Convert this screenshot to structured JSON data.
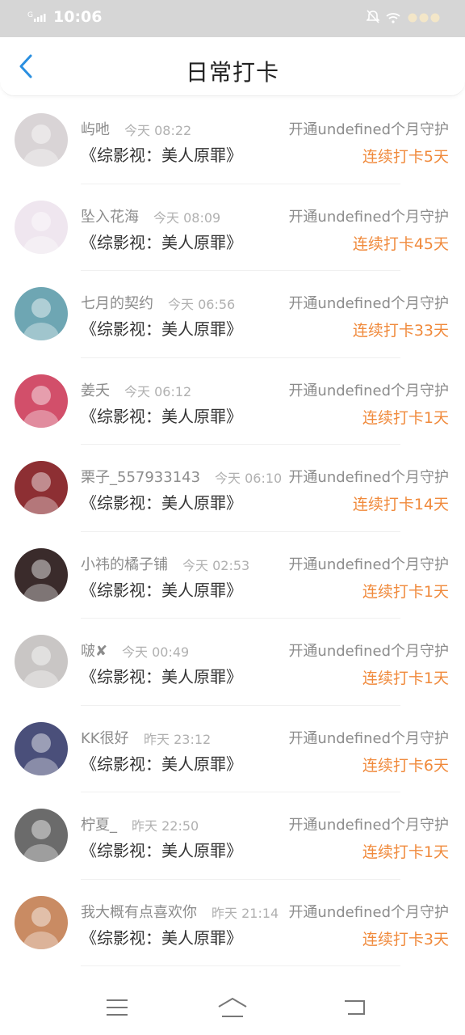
{
  "status_bar": {
    "time": "10:06",
    "network": "G"
  },
  "header": {
    "title": "日常打卡"
  },
  "rows": [
    {
      "username": "屿吔",
      "time": "今天 08:22",
      "guard": "开通undefined个月守护",
      "program": "《综影视：美人原罪》",
      "streak": "连续打卡5天",
      "avatar_color": "#d9d4d6"
    },
    {
      "username": "坠入花海",
      "time": "今天 08:09",
      "guard": "开通undefined个月守护",
      "program": "《综影视：美人原罪》",
      "streak": "连续打卡45天",
      "avatar_color": "#efe6ef"
    },
    {
      "username": "七月的契约",
      "time": "今天 06:56",
      "guard": "开通undefined个月守护",
      "program": "《综影视：美人原罪》",
      "streak": "连续打卡33天",
      "avatar_color": "#6ea6b3"
    },
    {
      "username": "姜夭",
      "time": "今天 06:12",
      "guard": "开通undefined个月守护",
      "program": "《综影视：美人原罪》",
      "streak": "连续打卡1天",
      "avatar_color": "#d24f6a"
    },
    {
      "username": "栗子_557933143",
      "time": "今天 06:10",
      "guard": "开通undefined个月守护",
      "program": "《综影视：美人原罪》",
      "streak": "连续打卡14天",
      "avatar_color": "#8d2f33"
    },
    {
      "username": "小祎的橘子铺",
      "time": "今天 02:53",
      "guard": "开通undefined个月守护",
      "program": "《综影视：美人原罪》",
      "streak": "连续打卡1天",
      "avatar_color": "#3a2b2b"
    },
    {
      "username": "啵✘",
      "time": "今天 00:49",
      "guard": "开通undefined个月守护",
      "program": "《综影视：美人原罪》",
      "streak": "连续打卡1天",
      "avatar_color": "#c9c6c5"
    },
    {
      "username": "KK很好",
      "time": "昨天 23:12",
      "guard": "开通undefined个月守护",
      "program": "《综影视：美人原罪》",
      "streak": "连续打卡6天",
      "avatar_color": "#4a4f7a"
    },
    {
      "username": "柠夏_",
      "time": "昨天 22:50",
      "guard": "开通undefined个月守护",
      "program": "《综影视：美人原罪》",
      "streak": "连续打卡1天",
      "avatar_color": "#6b6b6b"
    },
    {
      "username": "我大概有点喜欢你",
      "time": "昨天 21:14",
      "guard": "开通undefined个月守护",
      "program": "《综影视：美人原罪》",
      "streak": "连续打卡3天",
      "avatar_color": "#c98b63"
    }
  ]
}
